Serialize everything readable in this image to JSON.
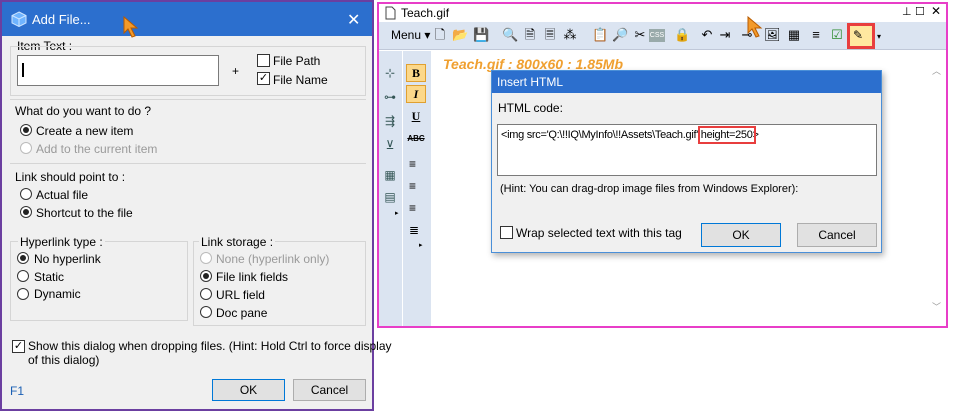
{
  "add_file": {
    "title": "Add File...",
    "item_text_label": "Item Text :",
    "item_text_value": "",
    "plus": "+",
    "file_path_label": "File Path",
    "file_name_label": "File Name",
    "file_path_checked": false,
    "file_name_checked": true,
    "what_label": "What do you want to do ?",
    "create_new": "Create a new item",
    "add_current": "Add to the current item",
    "link_label": "Link should point to :",
    "actual_file": "Actual file",
    "shortcut": "Shortcut to the file",
    "hyperlink_type_label": "Hyperlink type :",
    "no_hyperlink": "No hyperlink",
    "static": "Static",
    "dynamic": "Dynamic",
    "link_storage_label": "Link storage :",
    "none_hyperlink": "None (hyperlink only)",
    "file_link_fields": "File link fields",
    "url_field": "URL field",
    "doc_pane": "Doc pane",
    "show_dialog_line1": "Show this dialog when dropping files. (Hint: Hold Ctrl to force display",
    "show_dialog_line2": "of this dialog)",
    "show_dialog_checked": true,
    "f1": "F1",
    "ok": "OK",
    "cancel": "Cancel"
  },
  "teach": {
    "title": "Teach.gif",
    "menu": "Menu",
    "header": "Teach.gif : 800x60 : 1.85Mb",
    "format_buttons": [
      "B",
      "I",
      "U",
      "ABC"
    ]
  },
  "insert_html": {
    "title": "Insert HTML",
    "code_label": "HTML code:",
    "code_prefix": "<img src='Q:\\!!IQ\\MyInfo\\!!Assets\\Teach.gif' ",
    "code_highlight": "height=250",
    "code_suffix": ">",
    "hint": "(Hint: You can drag-drop image files from Windows Explorer):",
    "wrap_label": "Wrap selected text with this tag",
    "wrap_checked": false,
    "ok": "OK",
    "cancel": "Cancel"
  },
  "colors": {
    "titlebar": "#2c6fce",
    "highlight": "#e83e3e",
    "pink_border": "#e83ec8",
    "orange_text": "#f0a030"
  }
}
